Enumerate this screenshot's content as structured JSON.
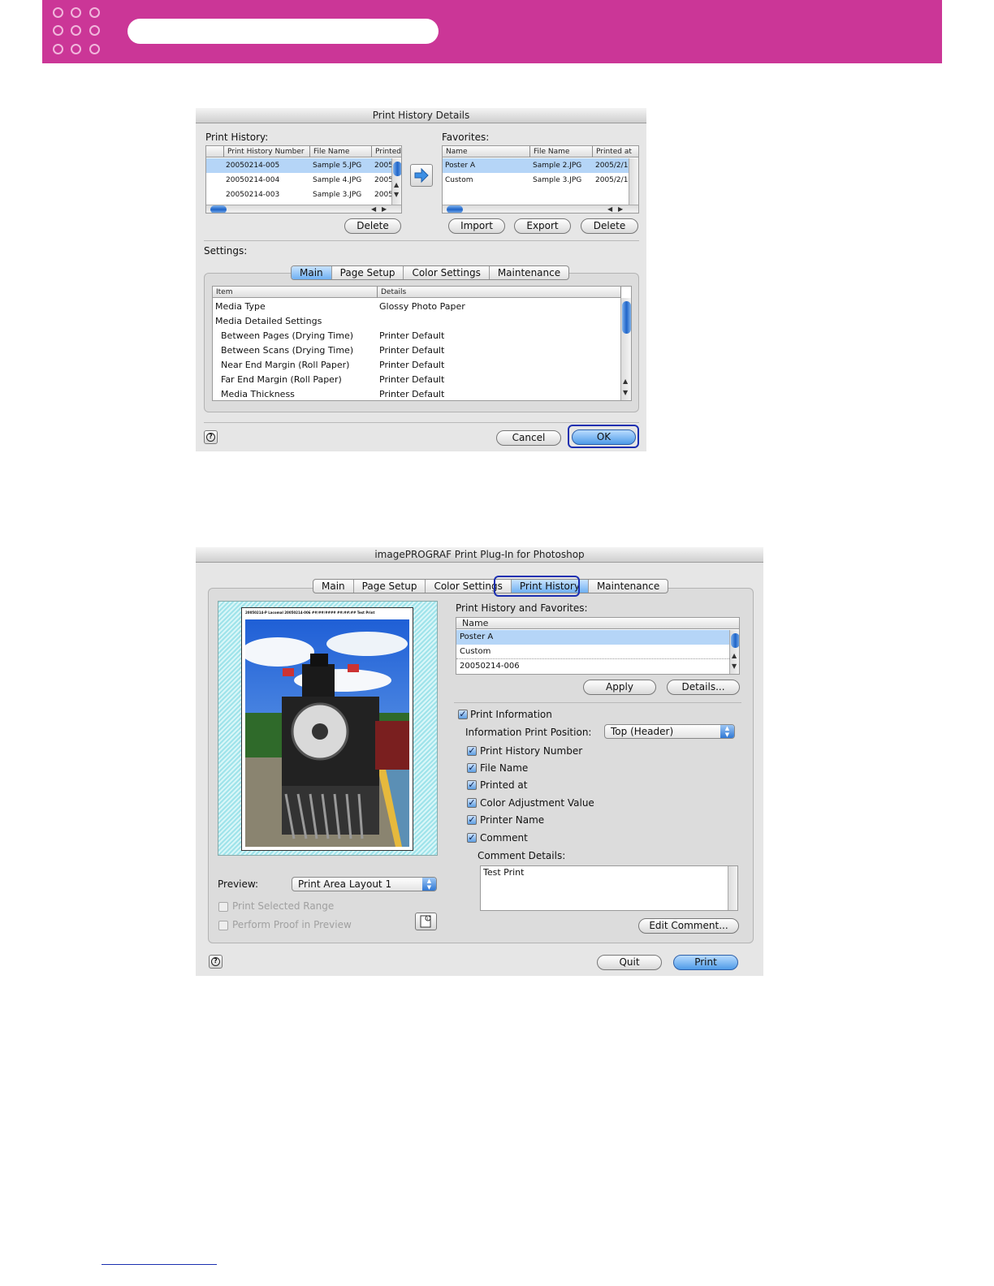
{
  "page": {
    "accent_color": "#cb3697"
  },
  "dialog1": {
    "title": "Print History Details",
    "print_history_label": "Print History:",
    "favorites_label": "Favorites:",
    "history_columns": [
      "Print History Number",
      "File Name",
      "Printed"
    ],
    "history_rows": [
      {
        "number": "20050214-005",
        "file": "Sample 5.JPG",
        "printed": "2005"
      },
      {
        "number": "20050214-004",
        "file": "Sample 4.JPG",
        "printed": "2005"
      },
      {
        "number": "20050214-003",
        "file": "Sample 3.JPG",
        "printed": "2005"
      }
    ],
    "favorites_columns": [
      "Name",
      "File Name",
      "Printed at"
    ],
    "favorites_rows": [
      {
        "name": "Poster A",
        "file": "Sample 2.JPG",
        "printed": "2005/2/1"
      },
      {
        "name": "Custom",
        "file": "Sample 3.JPG",
        "printed": "2005/2/1"
      }
    ],
    "add_to_favorites_icon": "right-arrow-icon",
    "delete_history_button": "Delete",
    "import_button": "Import",
    "export_button": "Export",
    "delete_favorites_button": "Delete",
    "settings_label": "Settings:",
    "tabs": [
      "Main",
      "Page Setup",
      "Color Settings",
      "Maintenance"
    ],
    "active_tab": "Main",
    "settings_columns": [
      "Item",
      "Details"
    ],
    "settings_rows": [
      {
        "item": "Media Type",
        "details": "Glossy Photo Paper",
        "indent": false
      },
      {
        "item": "Media Detailed Settings",
        "details": "",
        "indent": false
      },
      {
        "item": "Between Pages (Drying Time)",
        "details": "Printer Default",
        "indent": true
      },
      {
        "item": "Between Scans (Drying Time)",
        "details": "Printer Default",
        "indent": true
      },
      {
        "item": "Near End Margin (Roll Paper)",
        "details": "Printer Default",
        "indent": true
      },
      {
        "item": "Far End Margin (Roll Paper)",
        "details": "Printer Default",
        "indent": true
      },
      {
        "item": "Media Thickness",
        "details": "Printer Default",
        "indent": true
      }
    ],
    "cancel_button": "Cancel",
    "ok_button": "OK"
  },
  "dialog2": {
    "title": "imagePROGRAF Print Plug-In for Photoshop",
    "tabs": [
      "Main",
      "Page Setup",
      "Color Settings",
      "Print History",
      "Maintenance"
    ],
    "active_tab": "Print History",
    "preview_header_text": "20050214-P  Lacomal 20050214-006  ##/##/#### ##:##:##  Test Print",
    "preview_label": "Preview:",
    "preview_value": "Print Area Layout 1",
    "print_selected_range": "Print Selected Range",
    "perform_proof": "Perform Proof in Preview",
    "history_favorites_label": "Print History and Favorites:",
    "list_column": "Name",
    "list_rows": [
      "Poster A",
      "Custom",
      "20050214-006"
    ],
    "apply_button": "Apply",
    "details_button": "Details...",
    "print_information": "Print Information",
    "info_position_label": "Information Print Position:",
    "info_position_value": "Top (Header)",
    "options": [
      "Print History Number",
      "File Name",
      "Printed at",
      "Color Adjustment Value",
      "Printer Name",
      "Comment"
    ],
    "comment_details_label": "Comment Details:",
    "comment_text": "Test Print",
    "edit_comment_button": "Edit Comment...",
    "quit_button": "Quit",
    "print_button": "Print"
  }
}
